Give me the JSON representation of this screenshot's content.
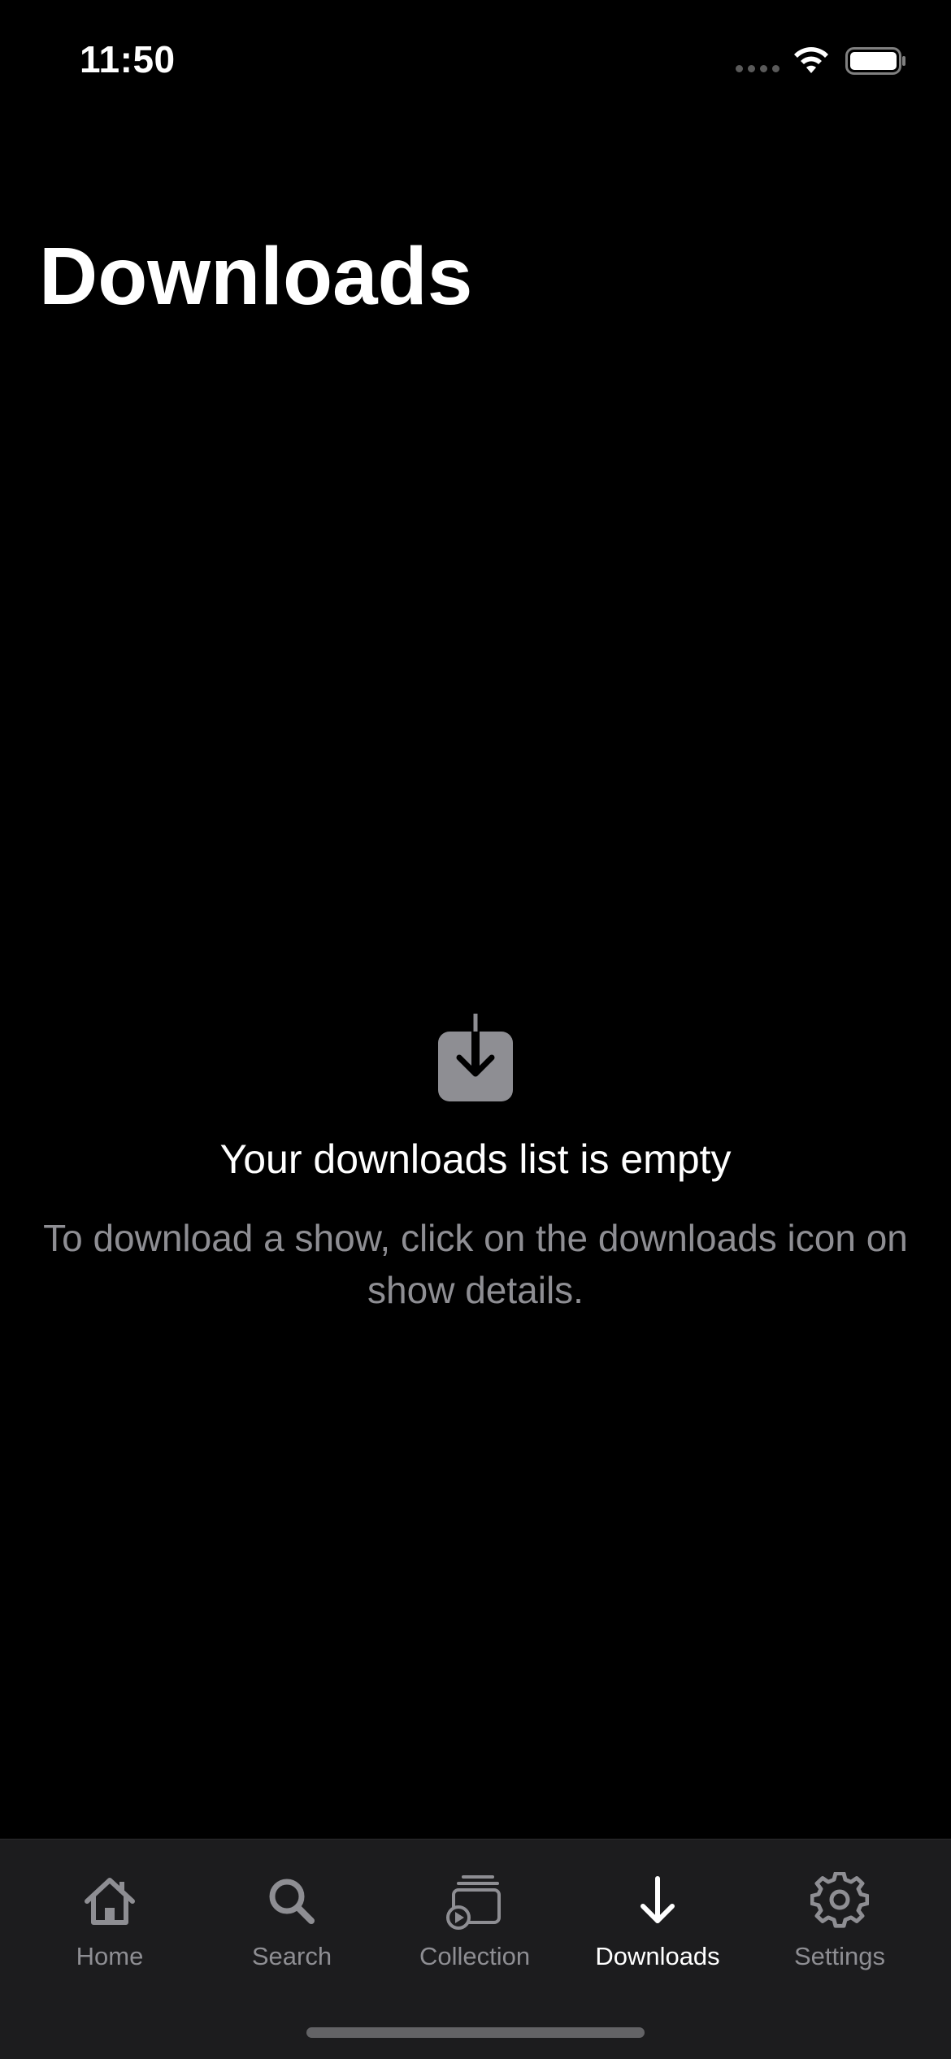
{
  "status_bar": {
    "time": "11:50"
  },
  "page": {
    "title": "Downloads"
  },
  "empty_state": {
    "title": "Your downloads list is empty",
    "description": "To download a show, click on the downloads icon on show details.",
    "icon": "download-tray-icon"
  },
  "tab_bar": {
    "tabs": [
      {
        "label": "Home",
        "icon": "house-icon",
        "active": false
      },
      {
        "label": "Search",
        "icon": "magnifier-icon",
        "active": false
      },
      {
        "label": "Collection",
        "icon": "stack-play-icon",
        "active": false
      },
      {
        "label": "Downloads",
        "icon": "arrow-down-icon",
        "active": true
      },
      {
        "label": "Settings",
        "icon": "gear-icon",
        "active": false
      }
    ]
  },
  "colors": {
    "background": "#000000",
    "tab_bar_background": "#1c1c1e",
    "active_tab": "#ffffff",
    "inactive_tab": "#8e8e93",
    "secondary_text": "#8e8e93"
  }
}
